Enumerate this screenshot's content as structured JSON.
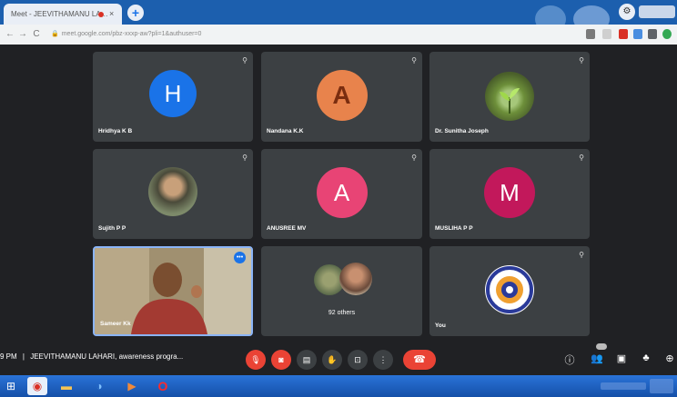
{
  "browser": {
    "tab_title": "Meet - JEEVITHAMANU LA…",
    "tab_close": "×",
    "new_tab_label": "+",
    "url": "meet.google.com/pbz-xxxp-aw?pli=1&authuser=0",
    "back_label": "←",
    "forward_label": "→",
    "reload_label": "C"
  },
  "participants": [
    {
      "name": "Hridhya K B",
      "type": "initial",
      "initial": "H",
      "color": "#1a73e8"
    },
    {
      "name": "Nandana K.K",
      "type": "initial",
      "initial": "A",
      "color": "#e8834c"
    },
    {
      "name": "Dr. Sunitha Joseph",
      "type": "photo",
      "icon": "plant-photo"
    },
    {
      "name": "Sujith P P",
      "type": "photo",
      "icon": "person-photo"
    },
    {
      "name": "ANUSREE MV",
      "type": "initial",
      "initial": "A",
      "color": "#e84475"
    },
    {
      "name": "MUSLIHA P P",
      "type": "initial",
      "initial": "M",
      "color": "#c2185b"
    },
    {
      "name": "Sameer Kk",
      "type": "video",
      "icon": "video-feed"
    },
    {
      "name": "92 others",
      "type": "group",
      "icon": "group-avatars"
    },
    {
      "name": "You",
      "type": "logo",
      "icon": "college-emblem"
    }
  ],
  "bottom_bar": {
    "time": "9 PM",
    "separator": "|",
    "meeting_title": "JEEVITHAMANU LAHARI, awareness progra..."
  },
  "icons": {
    "pin": "pin-icon",
    "mic_off": "mic-off-icon",
    "cam_off": "camera-off-icon",
    "captions": "captions-icon",
    "raise_hand": "raise-hand-icon",
    "present": "present-icon",
    "more": "more-options-icon",
    "hangup": "hangup-icon",
    "info": "info-icon",
    "people": "people-icon",
    "chat": "chat-icon",
    "activities": "activities-icon"
  },
  "colors": {
    "background": "#202124",
    "tile": "#3c4043",
    "danger": "#ea4335",
    "accent": "#1a73e8"
  }
}
